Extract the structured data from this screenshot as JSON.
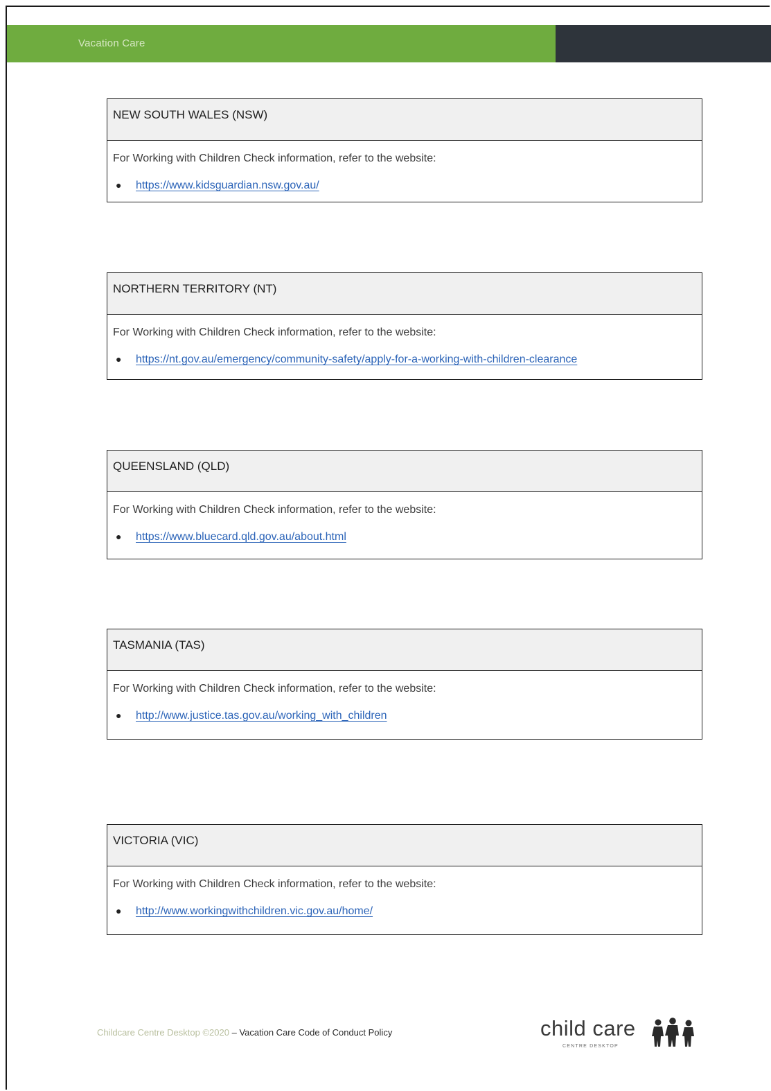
{
  "header": {
    "title": "Vacation Care"
  },
  "sections": [
    {
      "heading": "NEW SOUTH WALES (NSW)",
      "intro": "For Working with Children Check information, refer to the website:",
      "link": "https://www.kidsguardian.nsw.gov.au/"
    },
    {
      "heading": "NORTHERN TERRITORY (NT)",
      "intro": "For Working with Children Check information, refer to the website:",
      "link": "https://nt.gov.au/emergency/community-safety/apply-for-a-working-with-children-clearance"
    },
    {
      "heading": "QUEENSLAND (QLD)",
      "intro": "For Working with Children Check information, refer to the website:",
      "link": "https://www.bluecard.qld.gov.au/about.html"
    },
    {
      "heading": "TASMANIA (TAS)",
      "intro": "For Working with Children Check information, refer to the website:",
      "link": "http://www.justice.tas.gov.au/working_with_children"
    },
    {
      "heading": "VICTORIA (VIC)",
      "intro": "For Working with Children Check information, refer to the website:",
      "link": "http://www.workingwithchildren.vic.gov.au/home/"
    }
  ],
  "footer": {
    "copyright": "Childcare Centre Desktop ©2020",
    "separator": " – ",
    "policy": "Vacation Care Code of Conduct Policy"
  },
  "logo": {
    "wordmark": "child care",
    "tagline": "CENTRE DESKTOP",
    "icon": "children-silhouette-icon"
  },
  "colors": {
    "header_green": "#6fac3f",
    "header_dark": "#2e343b",
    "link": "#2c64b8"
  }
}
